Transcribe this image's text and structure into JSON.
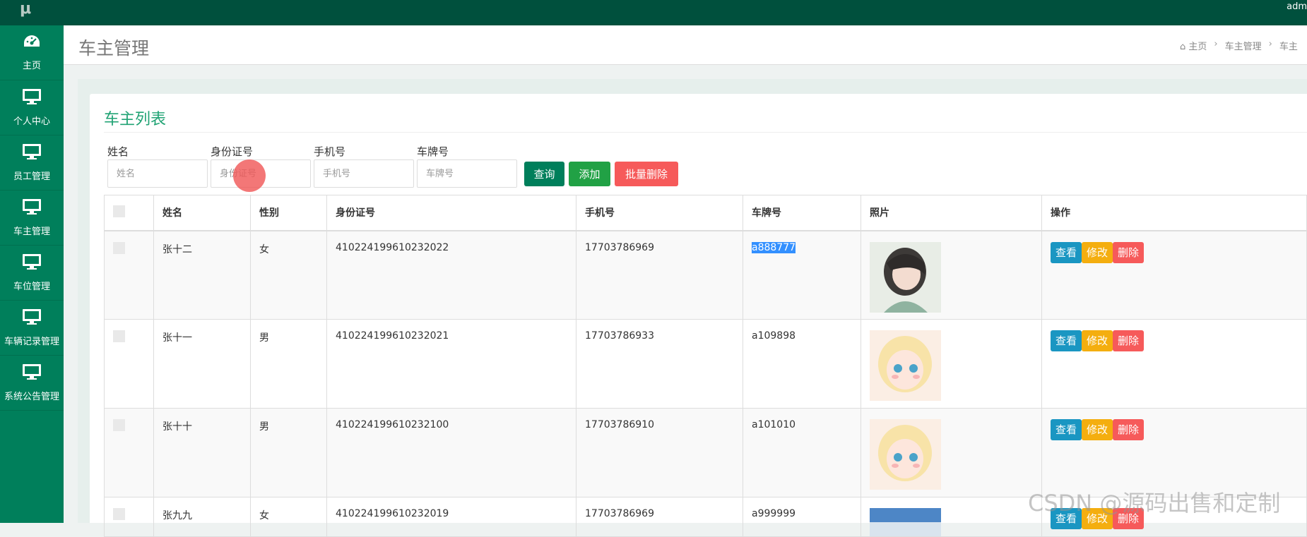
{
  "topbar": {
    "logo": "μ",
    "user": "adm"
  },
  "sidebar": {
    "items": [
      {
        "label": "主页",
        "icon": "dashboard-icon"
      },
      {
        "label": "个人中心",
        "icon": "monitor-icon"
      },
      {
        "label": "员工管理",
        "icon": "monitor-icon"
      },
      {
        "label": "车主管理",
        "icon": "monitor-icon"
      },
      {
        "label": "车位管理",
        "icon": "monitor-icon"
      },
      {
        "label": "车辆记录管理",
        "icon": "monitor-icon"
      },
      {
        "label": "系统公告管理",
        "icon": "monitor-icon"
      }
    ]
  },
  "header": {
    "title": "车主管理",
    "breadcrumb": {
      "home": "主页",
      "crumb1": "车主管理",
      "crumb2": "车主"
    }
  },
  "card": {
    "title": "车主列表"
  },
  "search": {
    "name": {
      "label": "姓名",
      "placeholder": "姓名"
    },
    "id_card": {
      "label": "身份证号",
      "placeholder": "身份证号"
    },
    "phone": {
      "label": "手机号",
      "placeholder": "手机号"
    },
    "plate": {
      "label": "车牌号",
      "placeholder": "车牌号"
    },
    "buttons": {
      "search": "查询",
      "add": "添加",
      "batch_delete": "批量删除"
    }
  },
  "table": {
    "columns": [
      "姓名",
      "性别",
      "身份证号",
      "手机号",
      "车牌号",
      "照片",
      "操作"
    ],
    "rows": [
      {
        "name": "张十二",
        "gender": "女",
        "id_card": "410224199610232022",
        "phone": "17703786969",
        "plate": "a888777"
      },
      {
        "name": "张十一",
        "gender": "男",
        "id_card": "410224199610232021",
        "phone": "17703786933",
        "plate": "a109898"
      },
      {
        "name": "张十十",
        "gender": "男",
        "id_card": "410224199610232100",
        "phone": "17703786910",
        "plate": "a101010"
      },
      {
        "name": "张九九",
        "gender": "女",
        "id_card": "410224199610232019",
        "phone": "17703786969",
        "plate": "a999999"
      }
    ],
    "actions": {
      "view": "查看",
      "edit": "修改",
      "delete": "删除"
    }
  },
  "watermark": "CSDN @源码出售和定制",
  "colors": {
    "topbar": "#00503d",
    "sidebar": "#007f5b",
    "accent": "#21a374"
  }
}
